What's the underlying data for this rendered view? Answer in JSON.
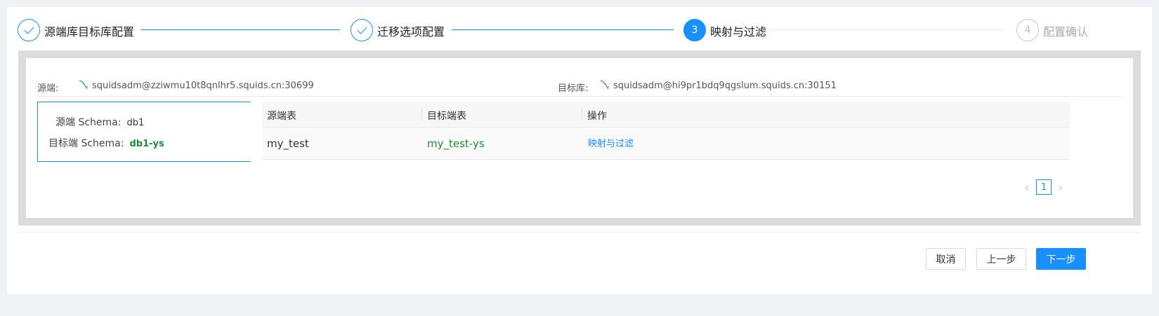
{
  "steps": [
    {
      "number": "1",
      "title": "源端库目标库配置",
      "status": "done"
    },
    {
      "number": "2",
      "title": "迁移选项配置",
      "status": "done"
    },
    {
      "number": "3",
      "title": "映射与过滤",
      "status": "active"
    },
    {
      "number": "4",
      "title": "配置确认",
      "status": "wait"
    }
  ],
  "connection": {
    "source_label": "源端:",
    "source_value": "squidsadm@zziwmu10t8qnlhr5.squids.cn:30699",
    "target_label": "目标库:",
    "target_value": "squidsadm@hi9pr1bdq9qgslum.squids.cn:30151",
    "db_icon": "mysql-dolphin-icon"
  },
  "schema": {
    "source_key": "源端 Schema:",
    "source_value": "db1",
    "target_key": "目标端 Schema:",
    "target_value": "db1-ys"
  },
  "table": {
    "headers": [
      "源端表",
      "目标端表",
      "操作"
    ],
    "rows": [
      {
        "source": "my_test",
        "target": "my_test-ys",
        "action": "映射与过滤"
      }
    ]
  },
  "pagination": {
    "current_page": "1",
    "prev_icon": "chevron-left-icon",
    "next_icon": "chevron-right-icon"
  },
  "footer": {
    "cancel_label": "取消",
    "prev_label": "上一步",
    "next_label": "下一步"
  },
  "colors": {
    "accent": "#1890ff",
    "target_text": "#1f8a3b"
  }
}
